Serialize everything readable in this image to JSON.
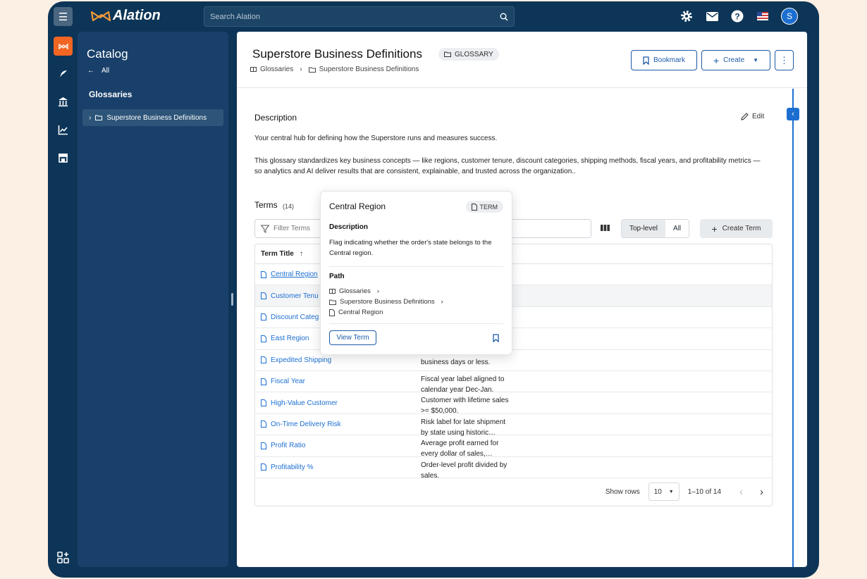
{
  "app": {
    "logo_text": "Alation"
  },
  "search": {
    "placeholder": "Search Alation"
  },
  "user": {
    "avatar_letter": "S"
  },
  "sidebar": {
    "title": "Catalog",
    "back_label": "All",
    "section": "Glossaries",
    "tree_item": "Superstore Business Definitions"
  },
  "header": {
    "title": "Superstore Business Definitions",
    "chip": "GLOSSARY",
    "crumb_root": "Glossaries",
    "crumb_current": "Superstore Business Definitions",
    "bookmark_label": "Bookmark",
    "create_label": "Create"
  },
  "description": {
    "heading": "Description",
    "edit_label": "Edit",
    "para1": "Your central hub for defining how the Superstore runs and measures success.",
    "para2": "This glossary standardizes key business concepts — like regions, customer tenure, discount categories, shipping methods, fiscal years, and profitability metrics — so analytics and AI deliver results that are consistent, explainable, and trusted across the organization.."
  },
  "terms": {
    "heading": "Terms",
    "count": "(14)",
    "filter_placeholder": "Filter Terms",
    "toggle_top": "Top-level",
    "toggle_all": "All",
    "create_label": "Create Term",
    "col_title": "Term Title",
    "rows": [
      {
        "title": "Central Region",
        "desc": ""
      },
      {
        "title": "Customer Tenu",
        "desc": ""
      },
      {
        "title": "Discount Categ",
        "desc": ""
      },
      {
        "title": "East Region",
        "desc": ""
      },
      {
        "title": "Expedited Shipping",
        "desc": "business days or less."
      },
      {
        "title": "Fiscal Year",
        "desc": "Fiscal year label aligned to\ncalendar year Dec-Jan."
      },
      {
        "title": "High-Value Customer",
        "desc": "Customer with lifetime sales\n>= $50,000."
      },
      {
        "title": "On-Time Delivery Risk",
        "desc": "Risk label for late shipment\nby state using historic…"
      },
      {
        "title": "Profit Ratio",
        "desc": "Average profit earned for\nevery dollar of sales,…"
      },
      {
        "title": "Profitability %",
        "desc": "Order-level profit divided by\nsales."
      }
    ],
    "show_rows_label": "Show rows",
    "rows_value": "10",
    "range": "1–10 of 14"
  },
  "popover": {
    "title": "Central Region",
    "chip": "TERM",
    "desc_heading": "Description",
    "desc": "Flag indicating whether the order's state belongs to the Central region.",
    "path_heading": "Path",
    "path_1": "Glossaries",
    "path_2": "Superstore Business Definitions",
    "path_3": "Central Region",
    "view_label": "View Term"
  },
  "colors": {
    "navy": "#0d3557",
    "accent": "#1c6fd0",
    "orange": "#f26522"
  }
}
